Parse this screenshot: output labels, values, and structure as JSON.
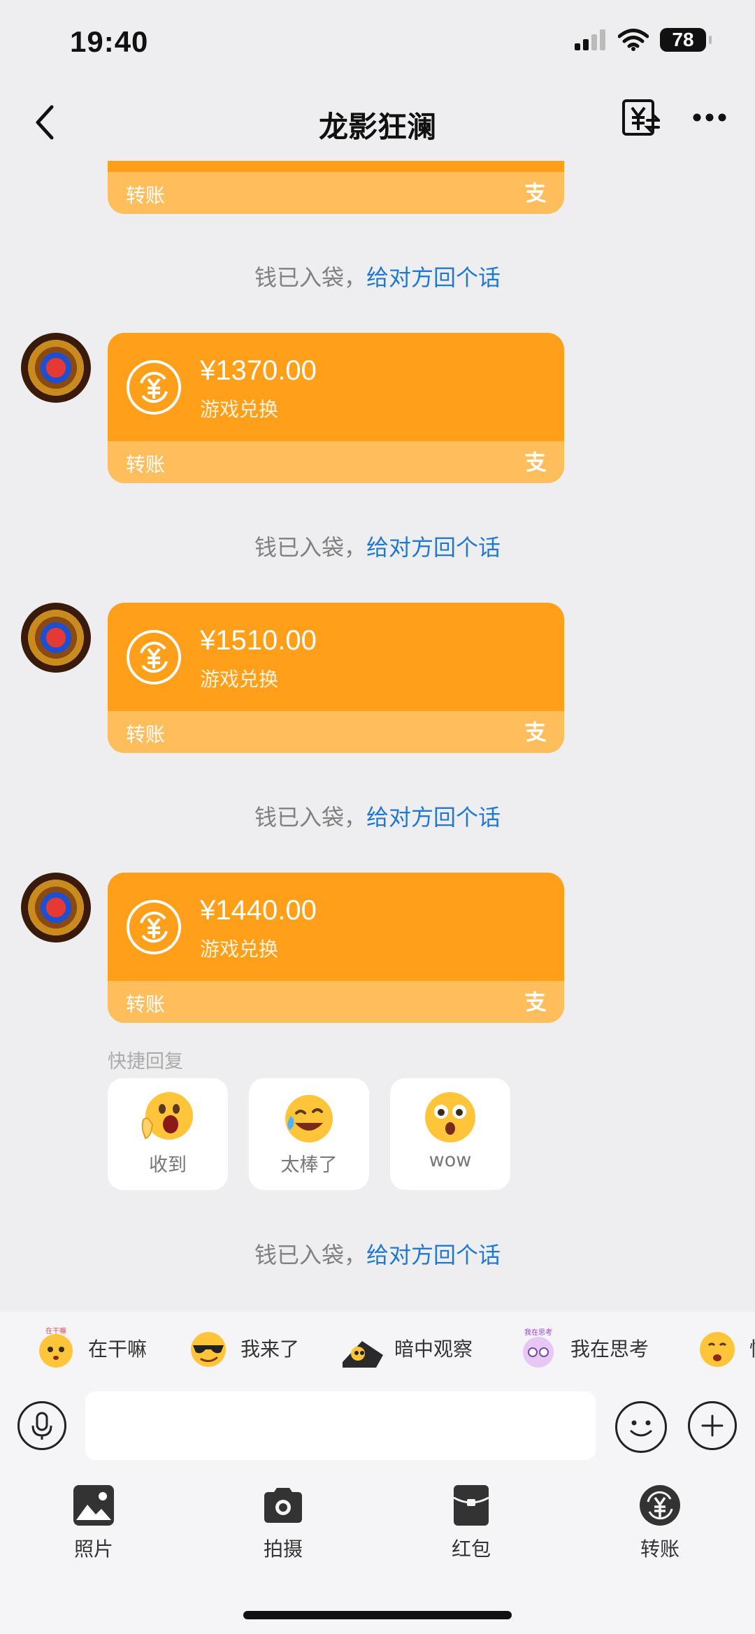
{
  "status_bar": {
    "time": "19:40",
    "battery": "78"
  },
  "header": {
    "title": "龙影狂澜"
  },
  "top_partial_card": {
    "label": "转账"
  },
  "messages": [
    {
      "amount": "¥1370.00",
      "subtitle": "游戏兑换",
      "label": "转账"
    },
    {
      "amount": "¥1510.00",
      "subtitle": "游戏兑换",
      "label": "转账"
    },
    {
      "amount": "¥1440.00",
      "subtitle": "游戏兑换",
      "label": "转账"
    }
  ],
  "system_notice": {
    "text": "钱已入袋，",
    "link": "给对方回个话"
  },
  "quick_reply": {
    "title": "快捷回复",
    "items": [
      {
        "label": "收到"
      },
      {
        "label": "太棒了"
      },
      {
        "label": "wow"
      }
    ]
  },
  "stickers": [
    {
      "label": "在干嘛",
      "badge": "在干嘛"
    },
    {
      "label": "我来了"
    },
    {
      "label": "暗中观察"
    },
    {
      "label": "我在思考",
      "badge": "我在思考"
    },
    {
      "label": "快"
    }
  ],
  "input": {
    "value": "",
    "placeholder": ""
  },
  "toolbar": [
    {
      "label": "照片"
    },
    {
      "label": "拍摄"
    },
    {
      "label": "红包"
    },
    {
      "label": "转账"
    }
  ],
  "colors": {
    "card": "#FF9F1A",
    "card_bottom": "#FFBE5C",
    "link": "#1F78D1",
    "background": "#EEEEF0"
  }
}
